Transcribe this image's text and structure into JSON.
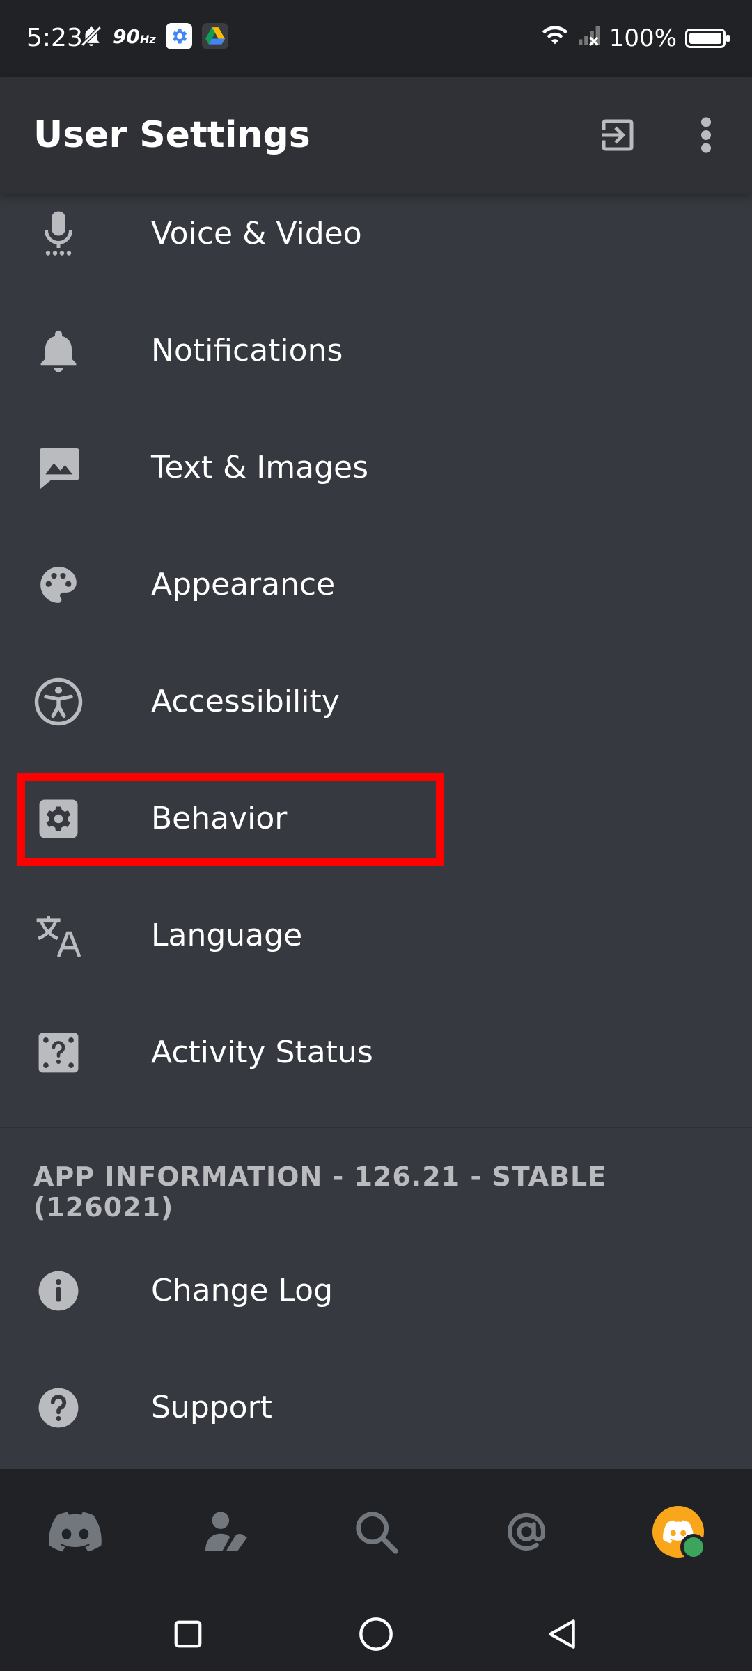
{
  "status_bar": {
    "time": "5:23",
    "refresh_rate": "90",
    "refresh_unit": "Hz",
    "battery": "100%"
  },
  "app_bar": {
    "title": "User Settings",
    "logout_icon": "logout-icon",
    "more_icon": "more-vert-icon"
  },
  "settings": {
    "items": [
      {
        "label": "Voice & Video",
        "icon": "microphone-icon"
      },
      {
        "label": "Notifications",
        "icon": "bell-icon"
      },
      {
        "label": "Text & Images",
        "icon": "image-icon"
      },
      {
        "label": "Appearance",
        "icon": "palette-icon"
      },
      {
        "label": "Accessibility",
        "icon": "accessibility-icon"
      },
      {
        "label": "Behavior",
        "icon": "gear-icon"
      },
      {
        "label": "Language",
        "icon": "translate-icon"
      },
      {
        "label": "Activity Status",
        "icon": "dice-icon"
      }
    ],
    "app_info_header": "APP INFORMATION - 126.21 - STABLE (126021)",
    "info_items": [
      {
        "label": "Change Log",
        "icon": "info-icon"
      },
      {
        "label": "Support",
        "icon": "help-icon"
      }
    ]
  },
  "bottom_nav": {
    "items": [
      "home-icon",
      "friends-icon",
      "search-icon",
      "mentions-icon",
      "profile-avatar"
    ]
  },
  "colors": {
    "background": "#36393f",
    "app_bar": "#2f3136",
    "nav": "#202225",
    "icon": "#b9bbbe",
    "highlight": "#ff0000",
    "avatar": "#faa61a",
    "online": "#3ba55c"
  }
}
